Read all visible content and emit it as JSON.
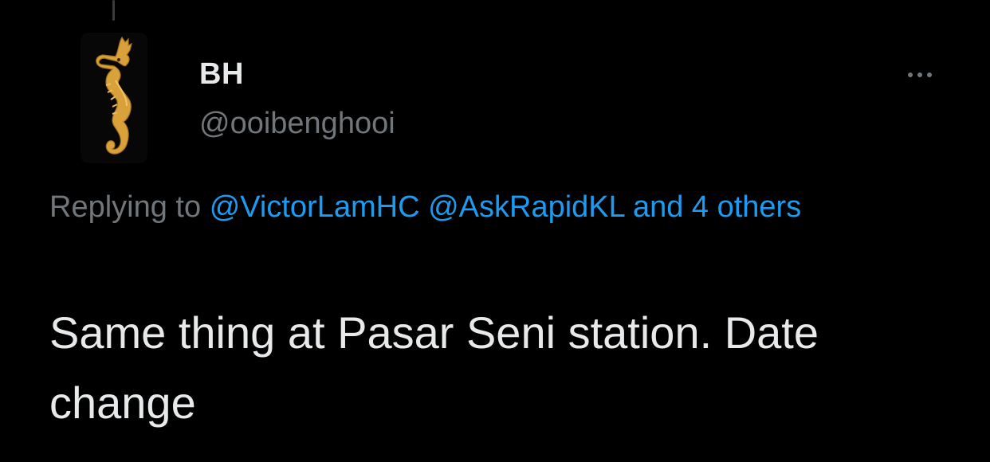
{
  "author": {
    "display_name": "BH",
    "handle": "@ooibenghooi"
  },
  "icons": {
    "avatar": "seahorse-avatar",
    "more": "more-horizontal-icon",
    "thread": "thread-connector-line"
  },
  "reply_context": {
    "prefix": "Replying to",
    "mentions": [
      "@VictorLamHC",
      "@AskRapidKL"
    ],
    "others": "and 4 others"
  },
  "tweet": {
    "text": "Same thing at Pasar Seni station. Date change"
  },
  "colors": {
    "background": "#000000",
    "text": "#e7e9ea",
    "secondary": "#71767b",
    "accent": "#1d9bf0"
  }
}
